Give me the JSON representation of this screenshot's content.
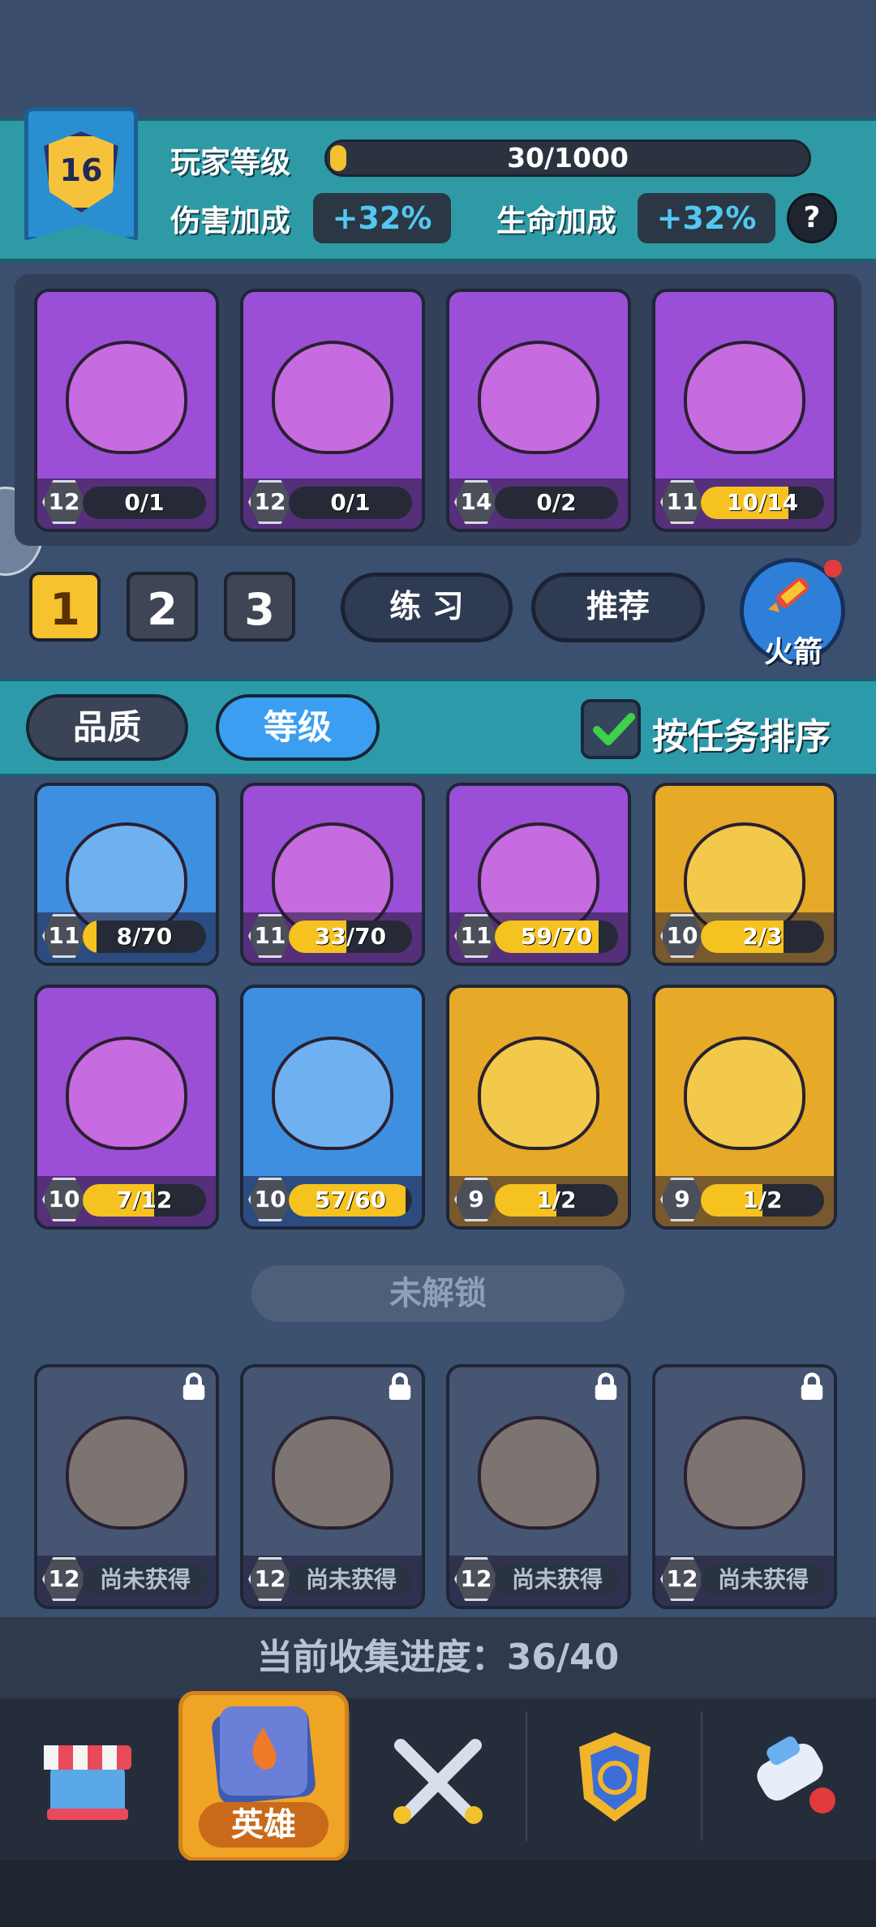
{
  "header": {
    "level": "16",
    "player_level_label": "玩家等级",
    "xp_text": "30/1000",
    "xp_fraction": 0.03,
    "damage_label": "伤害加成",
    "damage_value": "+32%",
    "health_label": "生命加成",
    "health_value": "+32%",
    "help_icon": "?"
  },
  "team": {
    "cards": [
      {
        "level": "12",
        "progress": "0/1",
        "fill": 0.0,
        "color": "purple",
        "icon": "emerald-knight-hero"
      },
      {
        "level": "12",
        "progress": "0/1",
        "fill": 0.0,
        "color": "purple",
        "icon": "white-monkey-hero"
      },
      {
        "level": "14",
        "progress": "0/2",
        "fill": 0.0,
        "color": "purple",
        "icon": "orange-lizard-hero"
      },
      {
        "level": "11",
        "progress": "10/14",
        "fill": 0.71,
        "color": "purple",
        "icon": "hook-orc-hero"
      }
    ],
    "tabs": [
      "1",
      "2",
      "3"
    ],
    "practice_label": "练 习",
    "recommend_label": "推荐",
    "rocket_label": "火箭"
  },
  "sort": {
    "quality_label": "品质",
    "level_label": "等级",
    "task_sort_label": "按任务排序",
    "task_sort_checked": true
  },
  "collection": {
    "row1": [
      {
        "level": "11",
        "progress": "8/70",
        "fill": 0.11,
        "color": "blue",
        "icon": "old-sage-hero"
      },
      {
        "level": "11",
        "progress": "33/70",
        "fill": 0.47,
        "color": "purple",
        "icon": "golden-warrior-hero"
      },
      {
        "level": "11",
        "progress": "59/70",
        "fill": 0.84,
        "color": "purple",
        "icon": "bandana-brute-hero"
      },
      {
        "level": "10",
        "progress": "2/3",
        "fill": 0.67,
        "color": "gold",
        "icon": "wolf-hero"
      }
    ],
    "row2": [
      {
        "level": "10",
        "progress": "7/12",
        "fill": 0.58,
        "color": "purple",
        "icon": "fire-monk-hero"
      },
      {
        "level": "10",
        "progress": "57/60",
        "fill": 0.95,
        "color": "blue",
        "icon": "viking-hero"
      },
      {
        "level": "9",
        "progress": "1/2",
        "fill": 0.5,
        "color": "gold",
        "icon": "rooster-boxer-hero"
      },
      {
        "level": "9",
        "progress": "1/2",
        "fill": 0.5,
        "color": "gold",
        "icon": "storm-wraith-hero"
      }
    ],
    "locked_title": "未解锁",
    "locked": [
      {
        "level": "12",
        "status": "尚未获得",
        "icon": "bald-monk-hero"
      },
      {
        "level": "12",
        "status": "尚未获得",
        "icon": "samurai-hero"
      },
      {
        "level": "12",
        "status": "尚未获得",
        "icon": "panda-hero"
      },
      {
        "level": "12",
        "status": "尚未获得",
        "icon": "top-hat-hero"
      }
    ]
  },
  "progress_text": "当前收集进度：36/40",
  "nav": {
    "items": [
      "shop-icon",
      "hero-icon",
      "battle-icon",
      "clan-icon",
      "power-icon"
    ],
    "active_label": "英雄"
  }
}
